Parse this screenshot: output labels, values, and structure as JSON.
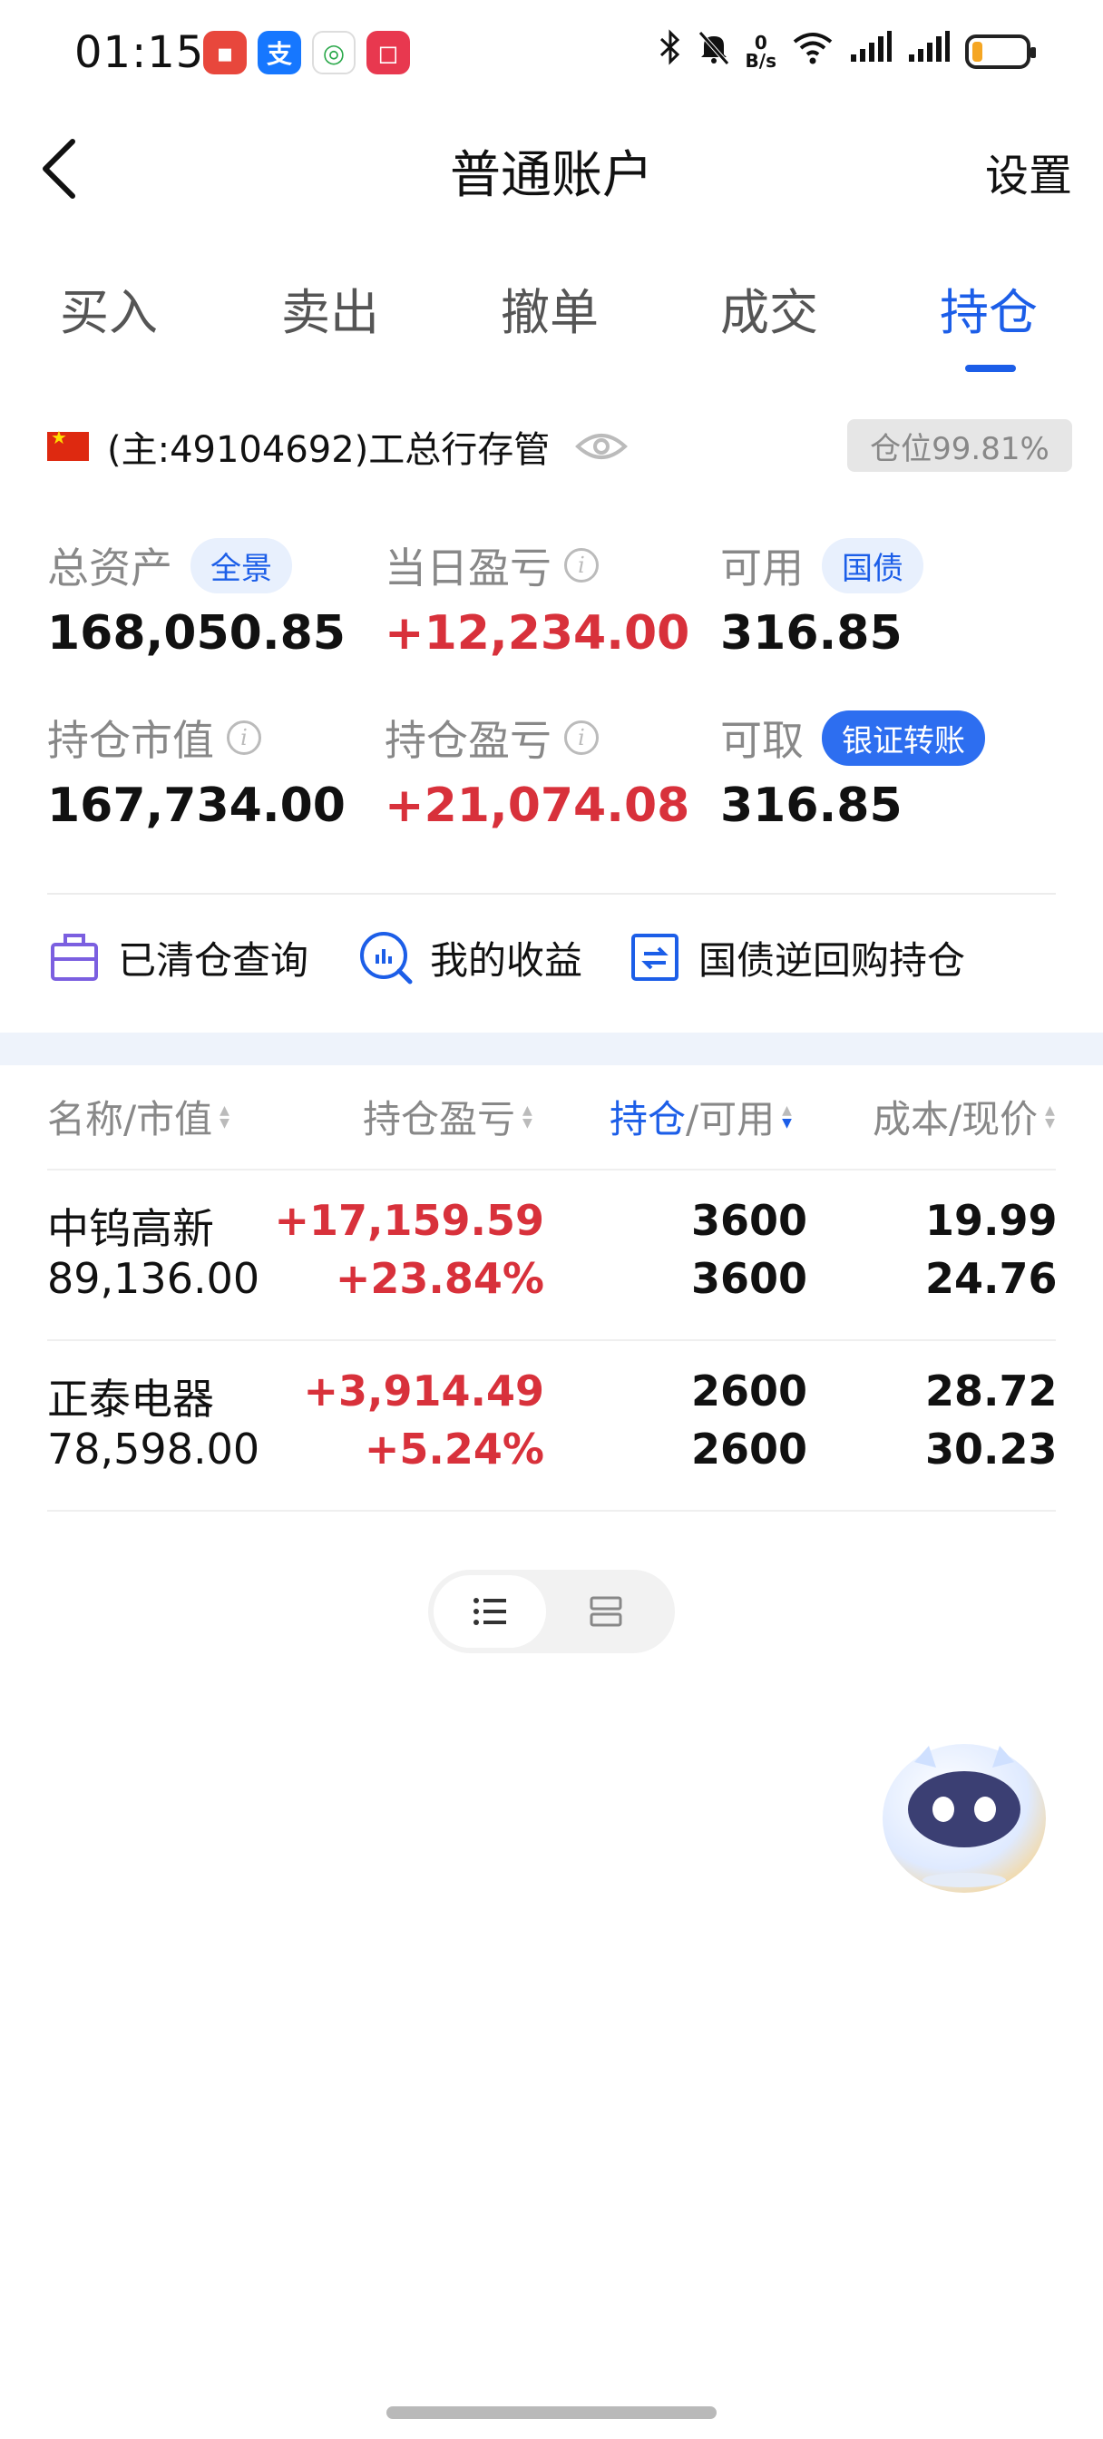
{
  "status_bar": {
    "time": "01:15",
    "net_speed_value": "0",
    "net_speed_unit": "B/s",
    "battery_level": 0.2,
    "icons": [
      "bluetooth-icon",
      "mute-icon",
      "wifi-icon",
      "signal-icon",
      "signal-icon",
      "battery-icon"
    ]
  },
  "header": {
    "title": "普通账户",
    "settings_label": "设置"
  },
  "tabs": [
    {
      "label": "买入"
    },
    {
      "label": "卖出"
    },
    {
      "label": "撤单"
    },
    {
      "label": "成交"
    },
    {
      "label": "持仓",
      "active": true
    }
  ],
  "account": {
    "label": "(主:49104692)工总行存管",
    "position_ratio": "仓位99.81%"
  },
  "metrics": {
    "total_assets": {
      "label": "总资产",
      "chip": "全景",
      "value": "168,050.85"
    },
    "daily_pnl": {
      "label": "当日盈亏",
      "value": "+12,234.00"
    },
    "available": {
      "label": "可用",
      "chip": "国债",
      "value": "316.85"
    },
    "market_value": {
      "label": "持仓市值",
      "value": "167,734.00"
    },
    "position_pnl": {
      "label": "持仓盈亏",
      "value": "+21,074.08"
    },
    "withdrawable": {
      "label": "可取",
      "chip": "银证转账",
      "value": "316.85"
    }
  },
  "quick_links": [
    {
      "label": "已清仓查询",
      "icon": "briefcase-icon"
    },
    {
      "label": "我的收益",
      "icon": "chart-icon"
    },
    {
      "label": "国债逆回购持仓",
      "icon": "repo-icon"
    }
  ],
  "table": {
    "headers": {
      "name": "名称/市值",
      "pnl": "持仓盈亏",
      "qty_a": "持仓",
      "qty_b": "/可用",
      "cost": "成本/现价"
    },
    "rows": [
      {
        "name": "中钨高新",
        "market_value": "89,136.00",
        "pnl": "+17,159.59",
        "pnl_pct": "+23.84%",
        "qty": "3600",
        "available": "3600",
        "cost": "19.993",
        "price": "24.760"
      },
      {
        "name": "正泰电器",
        "market_value": "78,598.00",
        "pnl": "+3,914.49",
        "pnl_pct": "+5.24%",
        "qty": "2600",
        "available": "2600",
        "cost": "28.724",
        "price": "30.230"
      }
    ]
  },
  "colors": {
    "accent": "#1c5ee8",
    "profit": "#d8313b"
  }
}
